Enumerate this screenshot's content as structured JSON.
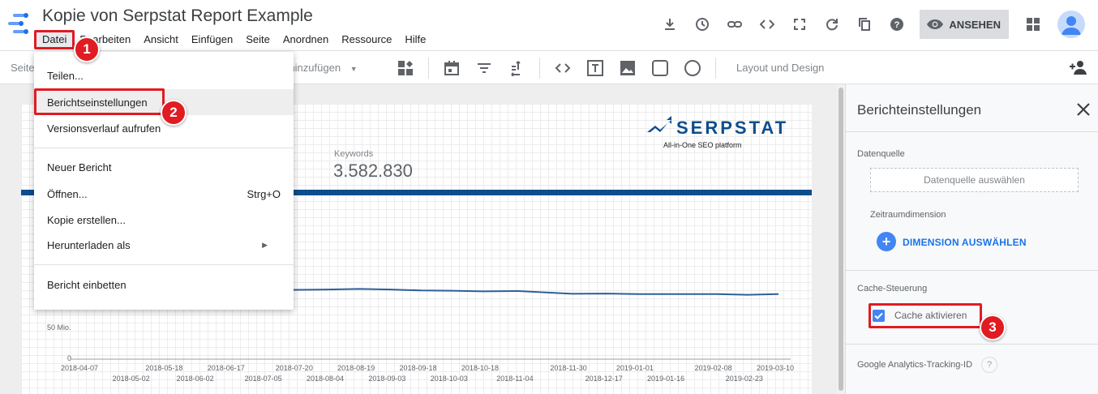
{
  "app": {
    "title": "Kopie von Serpstat Report Example",
    "accent_color": "#4285f4"
  },
  "menubar": {
    "items": [
      "Datei",
      "Bearbeiten",
      "Ansicht",
      "Einfügen",
      "Seite",
      "Anordnen",
      "Ressource",
      "Hilfe"
    ],
    "active": "Datei"
  },
  "header_actions": {
    "icons": [
      "download-icon",
      "history-icon",
      "link-icon",
      "embed-code-icon",
      "fullscreen-icon",
      "refresh-icon",
      "copy-icon",
      "help-icon"
    ],
    "view_button": "ANSEHEN"
  },
  "toolbar": {
    "page_label": "Seite",
    "filter_label": "m hinzufügen",
    "layout_label": "Layout und Design"
  },
  "datei_menu": {
    "items": [
      {
        "label": "Teilen...",
        "shortcut": ""
      },
      {
        "label": "Berichtseinstellungen",
        "shortcut": ""
      },
      {
        "label": "Versionsverlauf aufrufen",
        "shortcut": ""
      },
      {
        "label": "Neuer Bericht",
        "shortcut": ""
      },
      {
        "label": "Öffnen...",
        "shortcut": "Strg+O"
      },
      {
        "label": "Kopie erstellen...",
        "shortcut": ""
      },
      {
        "label": "Herunterladen als",
        "shortcut": ""
      },
      {
        "label": "Bericht einbetten",
        "shortcut": ""
      }
    ],
    "highlighted": "Berichtseinstellungen"
  },
  "report": {
    "brand": "SERPSTAT",
    "brand_tagline": "All-in-One SEO platform",
    "keywords_label": "Keywords",
    "keywords_value": "3.582.830",
    "brand_color": "#0e4d8c"
  },
  "chart_data": {
    "type": "line",
    "y_tick_labels": [
      "50 Mio.",
      "0"
    ],
    "x_tick_labels_top": [
      "2018-04-07",
      "2018-05-18",
      "2018-06-17",
      "2018-07-20",
      "2018-08-19",
      "2018-09-18",
      "2018-10-18",
      "2018-11-30",
      "2019-01-01",
      "2019-02-08",
      "2019-03-10"
    ],
    "x_tick_labels_bottom": [
      "2018-05-02",
      "2018-06-02",
      "2018-07-05",
      "2018-08-04",
      "2018-09-03",
      "2018-10-03",
      "2018-11-04",
      "2018-12-17",
      "2019-01-16",
      "2019-02-23"
    ],
    "series": [
      {
        "x": [
          "2018-07-05",
          "2018-07-20",
          "2018-08-04",
          "2018-08-19",
          "2018-09-03",
          "2018-09-18",
          "2018-10-03",
          "2018-10-18",
          "2018-11-04",
          "2018-11-30",
          "2018-12-17",
          "2019-01-01",
          "2019-01-16",
          "2019-02-08",
          "2019-02-23",
          "2019-03-10"
        ],
        "values": [
          112,
          112.5,
          113,
          114,
          113,
          111.5,
          111,
          110,
          110.5,
          106,
          106.5,
          105.5,
          105.5,
          105.5,
          104.5,
          105.5
        ]
      }
    ],
    "line_color": "#2d5f9a"
  },
  "panel": {
    "title": "Berichteinstellungen",
    "datasource_label": "Datenquelle",
    "datasource_button": "Datenquelle auswählen",
    "date_dim_label": "Zeitraumdimension",
    "dimension_button": "DIMENSION AUSWÄHLEN",
    "cache_section_label": "Cache-Steuerung",
    "cache_checkbox_label": "Cache aktivieren",
    "cache_checked": true,
    "ga_label": "Google Analytics-Tracking-ID",
    "ga_help": "?"
  },
  "annotations": {
    "badges": [
      "1",
      "2",
      "3"
    ],
    "color": "#e01b22"
  }
}
